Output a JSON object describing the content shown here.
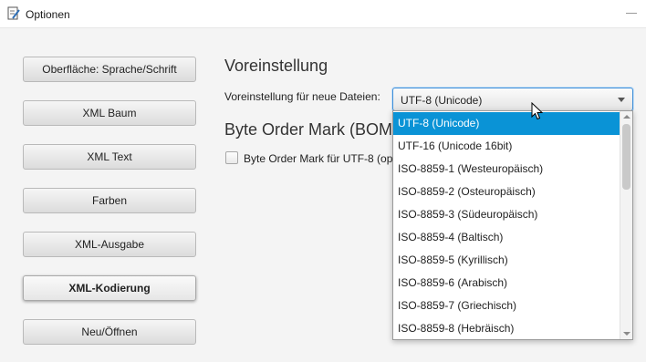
{
  "window": {
    "title": "Optionen"
  },
  "nav": {
    "items": [
      {
        "label": "Oberfläche: Sprache/Schrift"
      },
      {
        "label": "XML Baum"
      },
      {
        "label": "XML Text"
      },
      {
        "label": "Farben"
      },
      {
        "label": "XML-Ausgabe"
      },
      {
        "label": "XML-Kodierung",
        "active": true
      },
      {
        "label": "Neu/Öffnen"
      }
    ]
  },
  "main": {
    "section_default": "Voreinstellung",
    "default_label": "Voreinstellung für neue Dateien:",
    "encoding_select": {
      "value": "UTF-8 (Unicode)",
      "options": [
        "UTF-8 (Unicode)",
        "UTF-16 (Unicode 16bit)",
        "ISO-8859-1 (Westeuropäisch)",
        "ISO-8859-2 (Osteuropäisch)",
        "ISO-8859-3 (Südeuropäisch)",
        "ISO-8859-4 (Baltisch)",
        "ISO-8859-5 (Kyrillisch)",
        "ISO-8859-6 (Arabisch)",
        "ISO-8859-7 (Griechisch)",
        "ISO-8859-8 (Hebräisch)"
      ]
    },
    "section_bom": "Byte Order Mark (BOM",
    "bom_checkbox_label": "Byte Order Mark für UTF-8 (opt"
  },
  "colors": {
    "accent": "#0a93d6",
    "focus_border": "#3e8ed8"
  },
  "icons": {
    "app": "document-pencil-icon",
    "minimize": "minimize-icon",
    "cursor": "mouse-pointer-icon"
  }
}
